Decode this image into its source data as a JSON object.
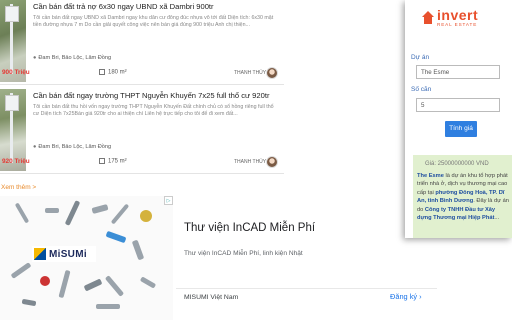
{
  "listings": [
    {
      "title": "Cần bán đất trả nợ 6x30 ngay UBND xã Dambri 900tr",
      "description": "Tôi cần bán đất  ngay UBND xã Dambri ngay khu dân cư đông đúc nhựa vô tới đất Diện tích: 6x30 mặt tiền đường nhựa 7 m Do cần giải quyết công việc nên bán giá đúng 900 triệu Anh chị thiện...",
      "location": "Đam Bri, Bảo Lộc, Lâm Đồng",
      "price": "900 Triệu",
      "area": "180 m²",
      "author": "THANH THỦY"
    },
    {
      "title": "Cần bán đất ngay trường THPT Nguyễn Khuyến 7x25 full thổ cư 920tr",
      "description": "Tôi cần bán đất thu hồi vốn ngay trường THPT Nguyễn Khuyến Đất chính chủ có sổ hồng riêng full thổ cư Diện tích 7x25Bán giá 920tr cho ai thiện chí Liên hệ trực tiếp cho tôi để đi xem đất...",
      "location": "Đam Bri, Bảo Lộc, Lâm Đồng",
      "price": "920 Triệu",
      "area": "175 m²",
      "author": "THANH THỦY"
    }
  ],
  "more_link": "Xem thêm >",
  "ad": {
    "brand": "MiSUMi",
    "title": "Thư viện InCAD Miễn Phí",
    "subtitle": "Thư viện InCAD Miễn Phí, linh kiện Nhật",
    "advertiser": "MISUMI Việt Nam",
    "cta": "Đăng ký  ›"
  },
  "sidebar": {
    "logo_main": "invert",
    "logo_sub": "REAL ESTATE",
    "project_label": "Dự án",
    "project_value": "The Esme",
    "rooms_label": "Số căn",
    "rooms_value": "5",
    "search_button": "Tính giá",
    "promo_price": "Giá: 25000000000 VND",
    "promo_p1": "The Esme",
    "promo_p2": " là dự án khu tổ hợp phát triển nhà ở, dịch vụ thương mại cao cấp tại ",
    "promo_p3": "phường Đông Hoà, TP. Dĩ An, tỉnh Bình Dương",
    "promo_p4": ". Đây là dự án do ",
    "promo_p5": "Công ty TNHH Đầu tư Xây dựng Thương mại Hiệp Phát",
    "promo_p6": "..."
  },
  "colors": {
    "price": "#e53935",
    "brand": "#e8502d",
    "button": "#2f7fe0",
    "link": "#1a73e8",
    "more_link": "#e88a2b",
    "promo_bg": "#e1f0cf"
  },
  "icons": [
    "location-pin-icon",
    "area-icon",
    "avatar",
    "logo-house-icon",
    "misumi-logo-icon",
    "ad-choices-icon"
  ]
}
